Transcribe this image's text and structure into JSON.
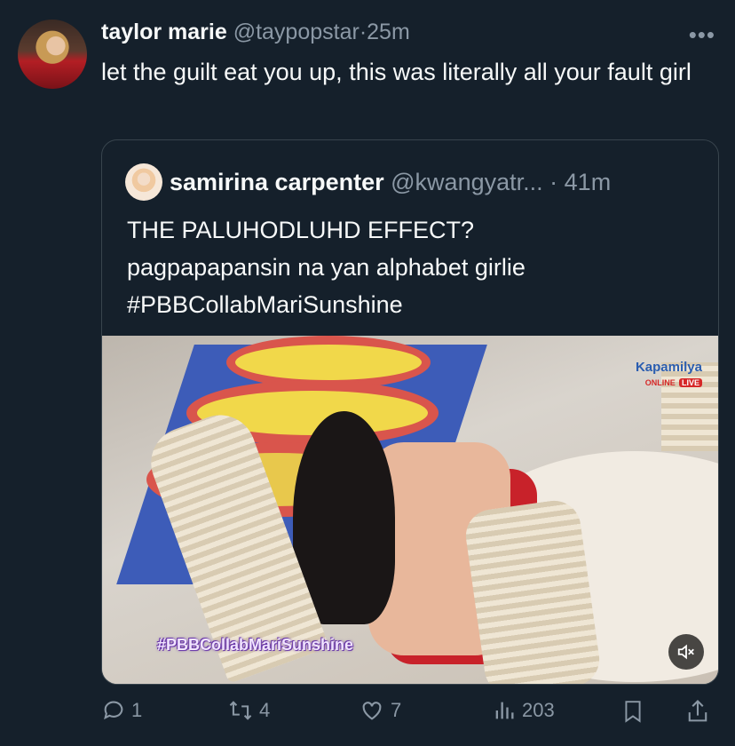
{
  "tweet": {
    "author_name": "taylor marie",
    "handle": "@taypopstar",
    "separator": "·",
    "time": "25m",
    "text": "let the guilt eat you up, this was literally all your fault girl",
    "more_label": "•••"
  },
  "quoted": {
    "author_name": "samirina carpenter",
    "handle": "@kwangyatr...",
    "separator": "·",
    "time": "41m",
    "text_lines": [
      "THE PALUHODLUHD EFFECT?",
      "pagpapapansin na yan alphabet girlie",
      "#PBBCollabMariSunshine"
    ],
    "video": {
      "logo": "Kapamilya",
      "logo_online": "ONLINE",
      "logo_live": "LIVE",
      "hashtag_overlay": "#PBBCollabMariSunshine",
      "muted": true
    }
  },
  "actions": {
    "replies": "1",
    "retweets": "4",
    "likes": "7",
    "views": "203"
  },
  "colors": {
    "background": "#15202b",
    "text_primary": "#f7f9f9",
    "text_secondary": "#8b98a5",
    "border": "#38444d"
  },
  "icons": [
    "reply-icon",
    "retweet-icon",
    "like-icon",
    "views-icon",
    "bookmark-icon",
    "share-icon",
    "mute-icon",
    "more-icon"
  ]
}
